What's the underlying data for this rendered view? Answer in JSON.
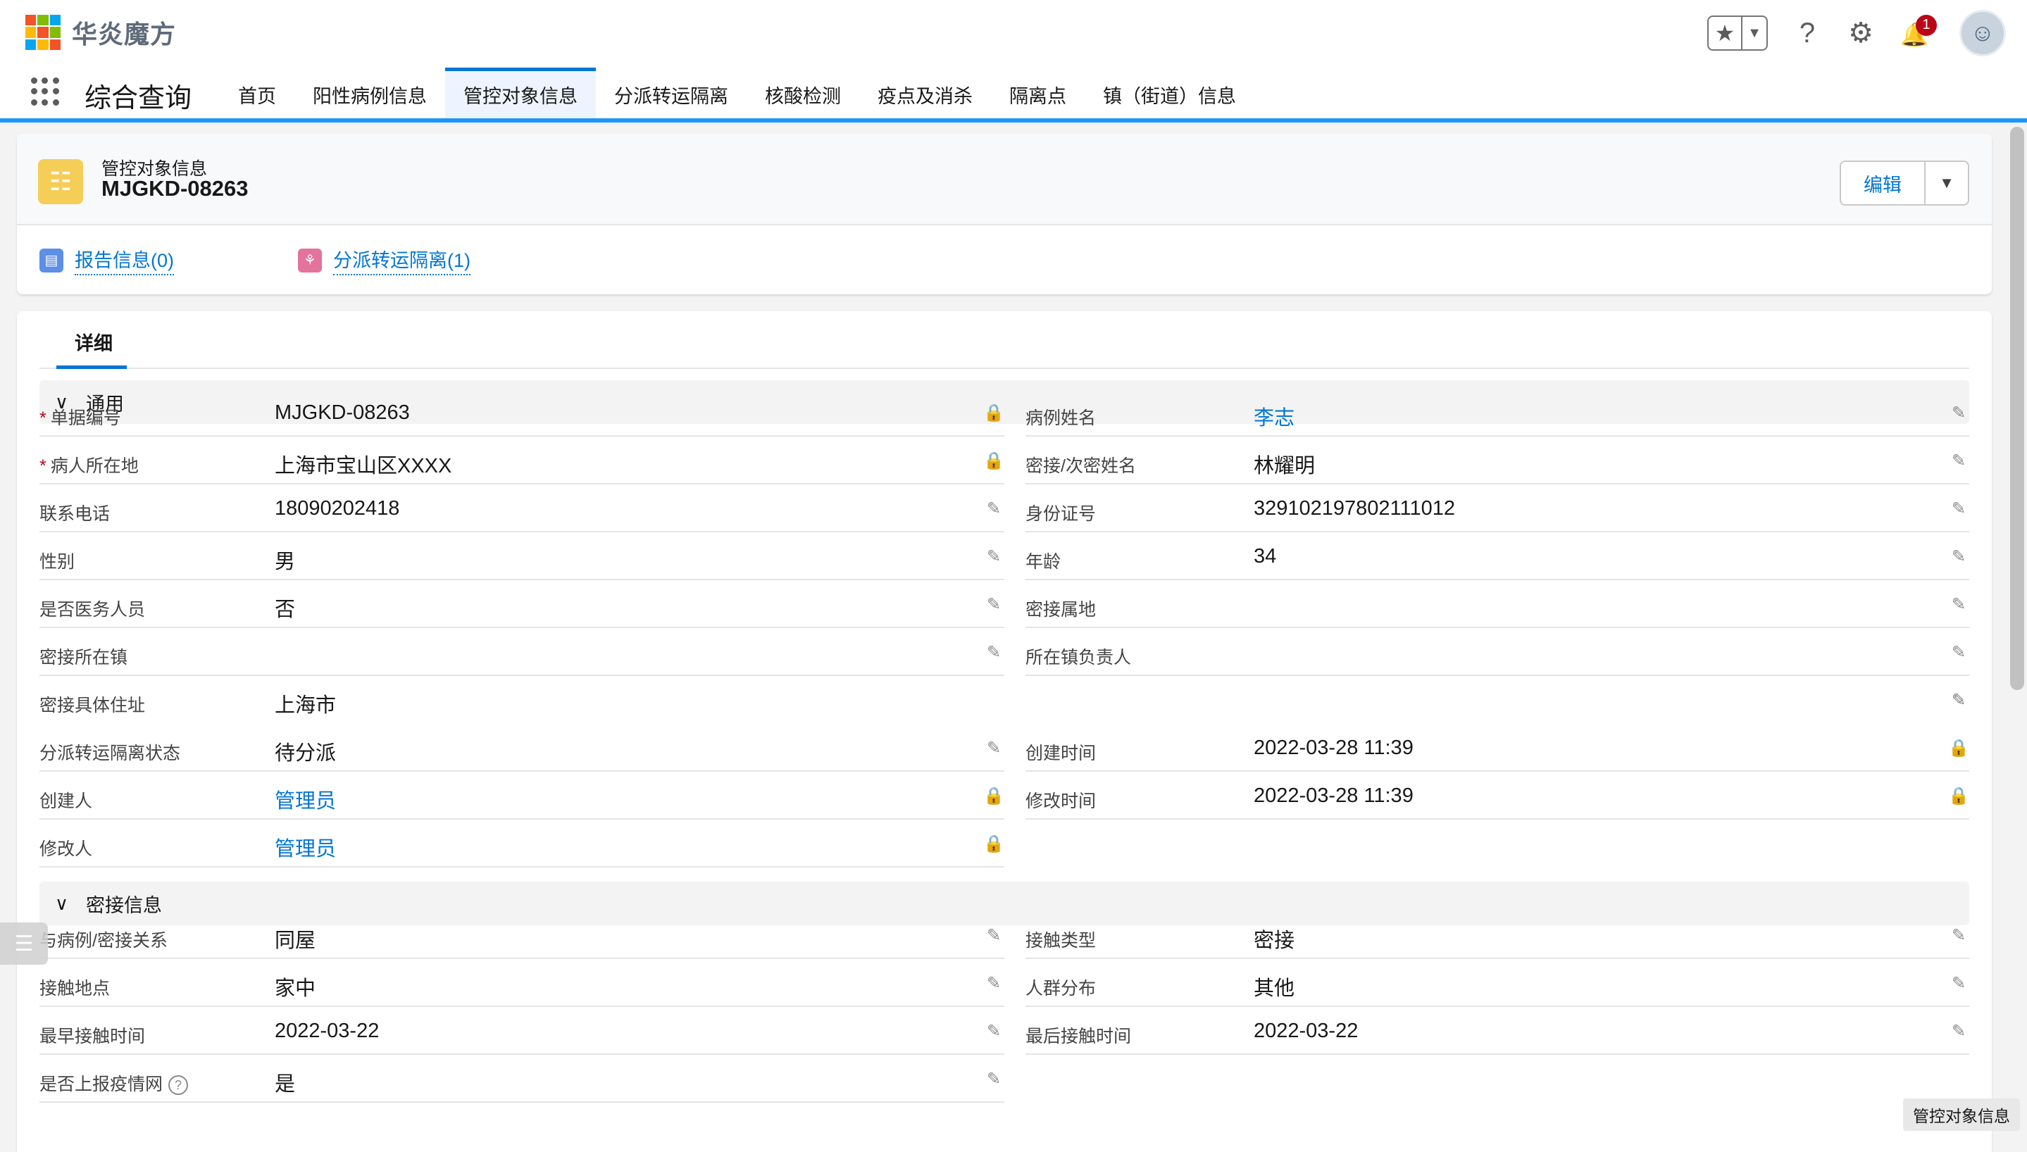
{
  "brand": {
    "name": "华炎魔方",
    "logo_colors": [
      "#f35325",
      "#81bc06",
      "#05a6f0",
      "#ffba08",
      "#f35325",
      "#81bc06",
      "#05a6f0",
      "#ffba08",
      "#f35325"
    ]
  },
  "header": {
    "star_icon": "★",
    "dropdown_icon": "▼",
    "help_icon": "?",
    "settings_icon": "⚙",
    "bell_icon": "🔔",
    "notification_count": "1",
    "avatar_icon": "☺"
  },
  "nav": {
    "app_name": "综合查询",
    "tabs": [
      {
        "label": "首页",
        "active": false
      },
      {
        "label": "阳性病例信息",
        "active": false
      },
      {
        "label": "管控对象信息",
        "active": true
      },
      {
        "label": "分派转运隔离",
        "active": false
      },
      {
        "label": "核酸检测",
        "active": false
      },
      {
        "label": "疫点及消杀",
        "active": false
      },
      {
        "label": "隔离点",
        "active": false
      },
      {
        "label": "镇（街道）信息",
        "active": false
      }
    ]
  },
  "record": {
    "object_type": "管控对象信息",
    "title": "MJGKD-08263",
    "edit_label": "编辑",
    "more_icon": "▼",
    "related": [
      {
        "label": "报告信息(0)",
        "color": "#5c8fe6",
        "icon": "▤"
      },
      {
        "label": "分派转运隔离(1)",
        "color": "#e3739b",
        "icon": "⚘"
      }
    ]
  },
  "detail": {
    "tab_label": "详细",
    "sections": {
      "general": {
        "title": "通用",
        "chevron": "∨",
        "left": [
          {
            "label": "单据编号",
            "required": true,
            "value": "MJGKD-08263",
            "link": false,
            "icon": "lock"
          },
          {
            "label": "病人所在地",
            "required": true,
            "value": "上海市宝山区XXXX",
            "link": false,
            "icon": "lock"
          },
          {
            "label": "联系电话",
            "required": false,
            "value": "18090202418",
            "link": false,
            "icon": "pencil"
          },
          {
            "label": "性别",
            "required": false,
            "value": "男",
            "link": false,
            "icon": "pencil"
          },
          {
            "label": "是否医务人员",
            "required": false,
            "value": "否",
            "link": false,
            "icon": "pencil"
          },
          {
            "label": "密接所在镇",
            "required": false,
            "value": "",
            "link": false,
            "icon": "pencil"
          }
        ],
        "right": [
          {
            "label": "病例姓名",
            "value": "李志",
            "link": true,
            "icon": "pencil"
          },
          {
            "label": "密接/次密姓名",
            "value": "林耀明",
            "link": false,
            "icon": "pencil"
          },
          {
            "label": "身份证号",
            "value": "329102197802111012",
            "link": false,
            "icon": "pencil"
          },
          {
            "label": "年龄",
            "value": "34",
            "link": false,
            "icon": "pencil"
          },
          {
            "label": "密接属地",
            "value": "",
            "link": false,
            "icon": "pencil"
          },
          {
            "label": "所在镇负责人",
            "value": "",
            "link": false,
            "icon": "pencil"
          }
        ],
        "address": {
          "label": "密接具体住址",
          "value": "上海市",
          "icon": "pencil"
        },
        "left2": [
          {
            "label": "分派转运隔离状态",
            "value": "待分派",
            "link": false,
            "icon": "pencil"
          },
          {
            "label": "创建人",
            "value": "管理员",
            "link": true,
            "icon": "lock"
          },
          {
            "label": "修改人",
            "value": "管理员",
            "link": true,
            "icon": "lock"
          }
        ],
        "right2": [
          {
            "label": "创建时间",
            "value": "2022-03-28 11:39",
            "link": false,
            "icon": "lock"
          },
          {
            "label": "修改时间",
            "value": "2022-03-28 11:39",
            "link": false,
            "icon": "lock"
          }
        ]
      },
      "contact": {
        "title": "密接信息",
        "chevron": "∨",
        "left": [
          {
            "label": "与病例/密接关系",
            "value": "同屋",
            "icon": "pencil"
          },
          {
            "label": "接触地点",
            "value": "家中",
            "icon": "pencil"
          },
          {
            "label": "最早接触时间",
            "value": "2022-03-22",
            "icon": "pencil"
          },
          {
            "label": "是否上报疫情网",
            "value": "是",
            "icon": "pencil",
            "help": "?"
          }
        ],
        "right": [
          {
            "label": "接触类型",
            "value": "密接",
            "icon": "pencil"
          },
          {
            "label": "人群分布",
            "value": "其他",
            "icon": "pencil"
          },
          {
            "label": "最后接触时间",
            "value": "2022-03-22",
            "icon": "pencil"
          }
        ]
      }
    }
  },
  "icons": {
    "lock": "🔒",
    "pencil": "✎",
    "list": "☰"
  },
  "footer_tip": "管控对象信息"
}
